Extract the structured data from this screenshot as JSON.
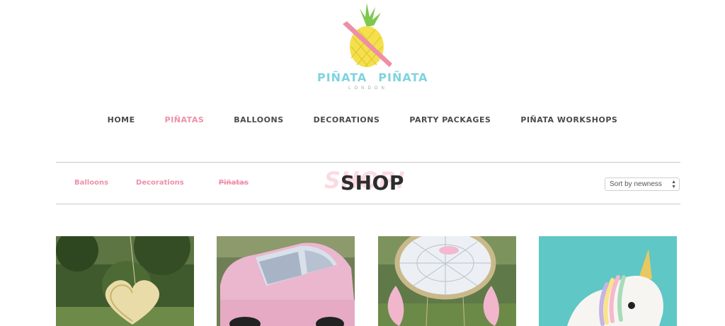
{
  "brand": {
    "word1": "PIÑATA",
    "word2": "PIÑATA",
    "sub": "LONDON",
    "colors": {
      "leaf": "#7ec850",
      "pineapple": "#f4e04d",
      "bat": "#ee8fa8",
      "text": "#7fd3de"
    }
  },
  "nav": {
    "items": [
      {
        "label": "HOME",
        "active": false
      },
      {
        "label": "PIÑATAS",
        "active": true
      },
      {
        "label": "BALLOONS",
        "active": false
      },
      {
        "label": "DECORATIONS",
        "active": false
      },
      {
        "label": "PARTY PACKAGES",
        "active": false
      },
      {
        "label": "PIÑATA WORKSHOPS",
        "active": false
      }
    ]
  },
  "shop": {
    "title": "SHOP",
    "watermark": "SHOP!",
    "categories": [
      {
        "label": "Balloons"
      },
      {
        "label": "Decorations"
      },
      {
        "label": "Piñatas"
      }
    ],
    "sort": {
      "selected": "Sort by newness"
    }
  },
  "products": [
    {
      "image": "gold-heart-pinata"
    },
    {
      "image": "pink-car-pinata"
    },
    {
      "image": "dreamcatcher-pinata"
    },
    {
      "image": "unicorn-pinata"
    }
  ]
}
